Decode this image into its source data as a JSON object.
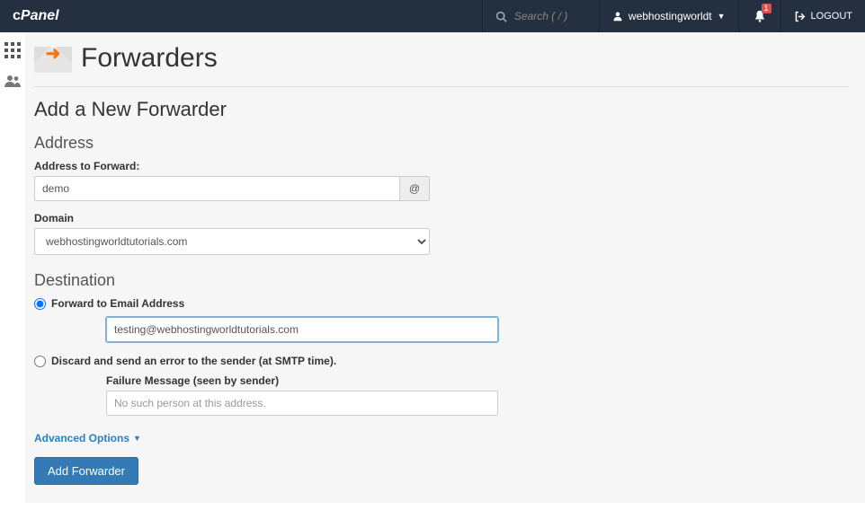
{
  "nav": {
    "search_placeholder": "Search ( / )",
    "username": "webhostingworldt",
    "notification_count": "1",
    "logout": "LOGOUT"
  },
  "page": {
    "title": "Forwarders",
    "subtitle": "Add a New Forwarder"
  },
  "address": {
    "section": "Address",
    "label": "Address to Forward:",
    "value": "demo",
    "at": "@",
    "domain_label": "Domain",
    "domain_value": "webhostingworldtutorials.com"
  },
  "destination": {
    "section": "Destination",
    "forward_label": "Forward to Email Address",
    "forward_value": "testing@webhostingworldtutorials.com",
    "discard_label": "Discard and send an error to the sender (at SMTP time).",
    "failure_label": "Failure Message (seen by sender)",
    "failure_placeholder": "No such person at this address."
  },
  "advanced_label": "Advanced Options",
  "submit_label": "Add Forwarder"
}
